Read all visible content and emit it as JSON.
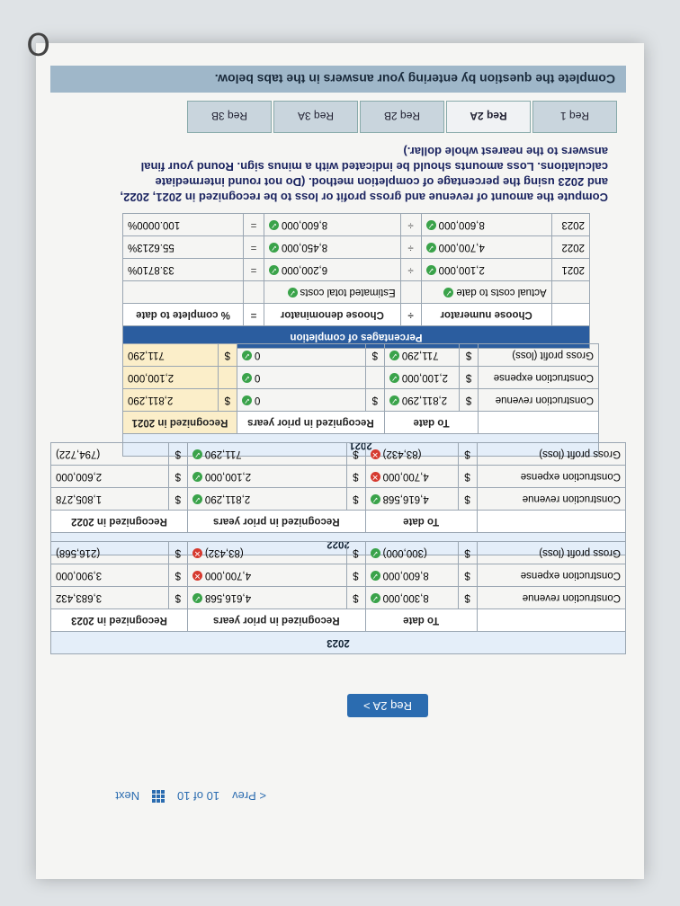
{
  "instruction": "Complete the question by entering your answers in the tabs below.",
  "tabs": [
    "Req 1",
    "Req 2A",
    "Req 2B",
    "Req 3A",
    "Req 3B"
  ],
  "active_tab": "Req 2A",
  "question": "Compute the amount of revenue and gross profit or loss to be recognized in 2021, 2022, and 2023 using the percentage of completion method. (Do not round intermediate calculations. Loss amounts should be indicated with a minus sign. Round your final answers to the nearest whole dollar.)",
  "pct_table": {
    "title": "Percentages of completion",
    "headers": [
      "Choose numerator",
      "÷",
      "Choose denominator",
      "=",
      "% complete to date"
    ],
    "subheaders": [
      "Actual costs to date",
      "Estimated total costs"
    ],
    "rows": [
      {
        "year": "2021",
        "num": "2,100,000",
        "den": "6,200,000",
        "pct": "33.8710%"
      },
      {
        "year": "2022",
        "num": "4,700,000",
        "den": "8,450,000",
        "pct": "55.6213%"
      },
      {
        "year": "2023",
        "num": "8,600,000",
        "den": "8,600,000",
        "pct": "100.0000%"
      }
    ]
  },
  "t2021": {
    "year": "2021",
    "col_to_date": "To date",
    "col_prior": "Recognized in prior years",
    "col_current": "Recognized in 2021",
    "rows": [
      {
        "label": "Construction revenue",
        "to_date": "2,811,290",
        "prior": "0",
        "current": "2,811,290"
      },
      {
        "label": "Construction expense",
        "to_date": "2,100,000",
        "prior": "0",
        "current": "2,100,000"
      },
      {
        "label": "Gross profit (loss)",
        "to_date": "711,290",
        "prior": "0",
        "current": "711,290"
      }
    ]
  },
  "t2022": {
    "year": "2022",
    "col_to_date": "To date",
    "col_prior": "Recognized in prior years",
    "col_current": "Recognized in 2022",
    "rows": [
      {
        "label": "Construction revenue",
        "to_date": "4,616,568",
        "prior": "2,811,290",
        "current": "1,805,278",
        "status": "ok"
      },
      {
        "label": "Construction expense",
        "to_date": "4,700,000",
        "prior": "2,100,000",
        "current": "2,600,000",
        "status": "bad"
      },
      {
        "label": "Gross profit (loss)",
        "to_date": "(83,432)",
        "prior": "711,290",
        "current": "(794,722)",
        "status": "bad"
      }
    ]
  },
  "t2023": {
    "year": "2023",
    "col_to_date": "To date",
    "col_prior": "Recognized in prior years",
    "col_current": "Recognized in 2023",
    "rows": [
      {
        "label": "Construction revenue",
        "to_date": "8,300,000",
        "prior": "4,616,568",
        "current": "3,683,432"
      },
      {
        "label": "Construction expense",
        "to_date": "8,600,000",
        "prior": "4,700,000",
        "current": "3,900,000"
      },
      {
        "label": "Gross profit (loss)",
        "to_date": "(300,000)",
        "prior": "(83,432)",
        "current": "(216,568)"
      }
    ]
  },
  "nav": {
    "next_tab_label": "Req 2A >",
    "prev": "< Prev",
    "page": "10 of 10",
    "next": "Next"
  },
  "corner": "O"
}
